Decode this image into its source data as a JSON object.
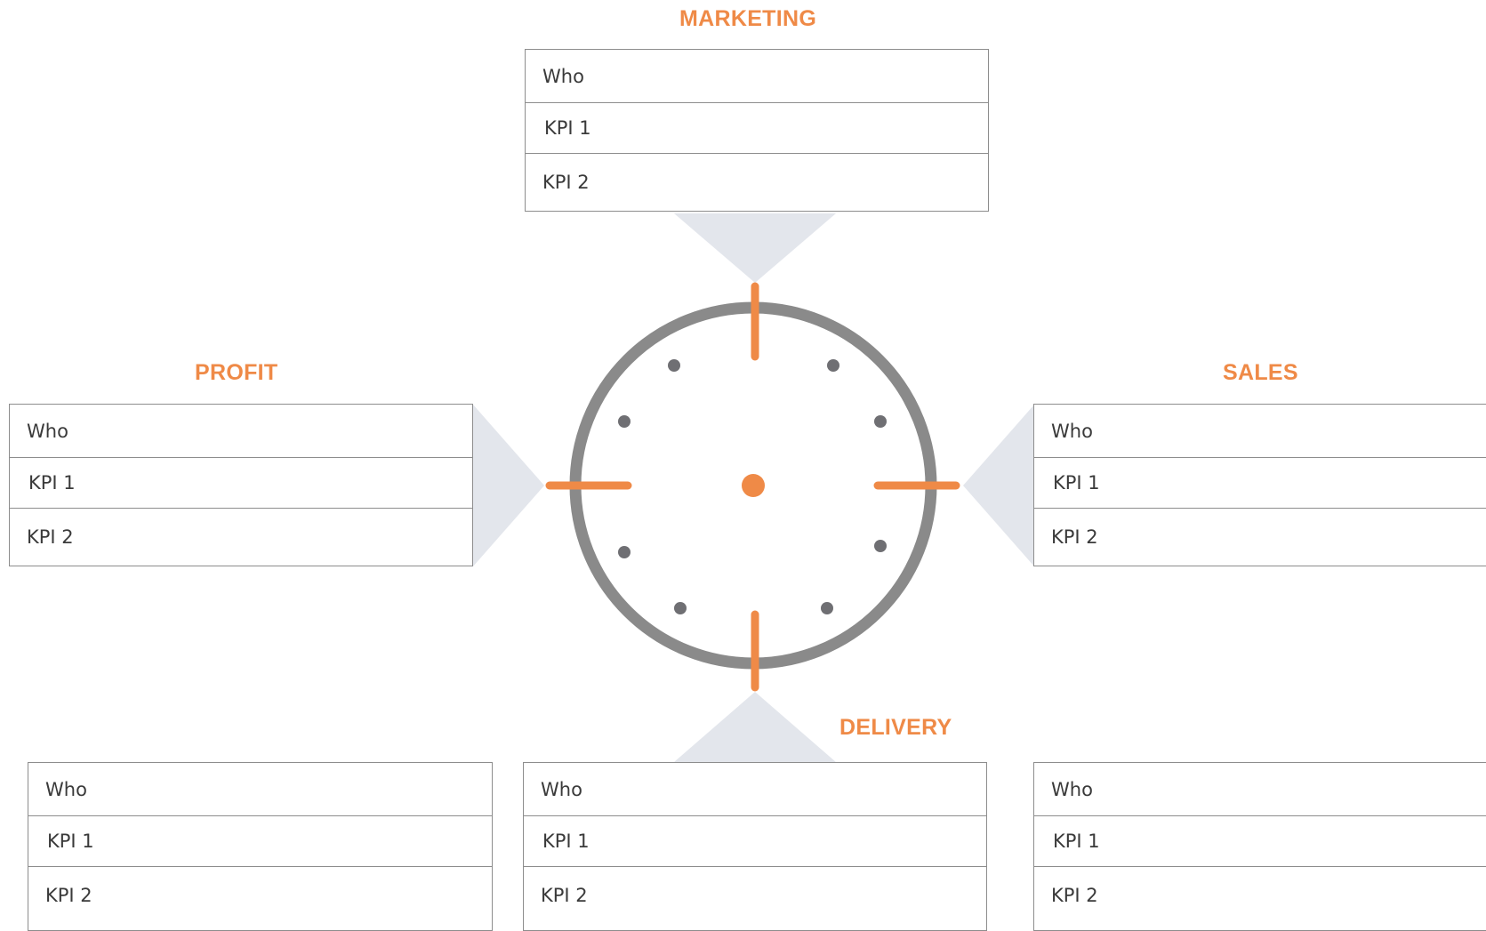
{
  "colors": {
    "accent": "#ef8a47",
    "ring": "#8a8a8a",
    "dot": "#6f6f73",
    "connector": "#e3e6ec",
    "table_border": "#8d8d8d",
    "text": "#3a3a3a"
  },
  "icon": "target-crosshair-icon",
  "sections": {
    "marketing": {
      "title": "MARKETING",
      "rows": [
        "Who",
        "KPI 1",
        "KPI 2"
      ]
    },
    "profit": {
      "title": "PROFIT",
      "rows": [
        "Who",
        "KPI 1",
        "KPI 2"
      ]
    },
    "sales": {
      "title": "SALES",
      "rows": [
        "Who",
        "KPI 1",
        "KPI 2"
      ]
    },
    "delivery": {
      "title": "DELIVERY",
      "rows": [
        "Who",
        "KPI 1",
        "KPI 2"
      ]
    }
  },
  "extra_tables": {
    "bottom_left": {
      "rows": [
        "Who",
        "KPI 1",
        "KPI 2"
      ]
    },
    "bottom_right": {
      "rows": [
        "Who",
        "KPI 1",
        "KPI 2"
      ]
    }
  }
}
